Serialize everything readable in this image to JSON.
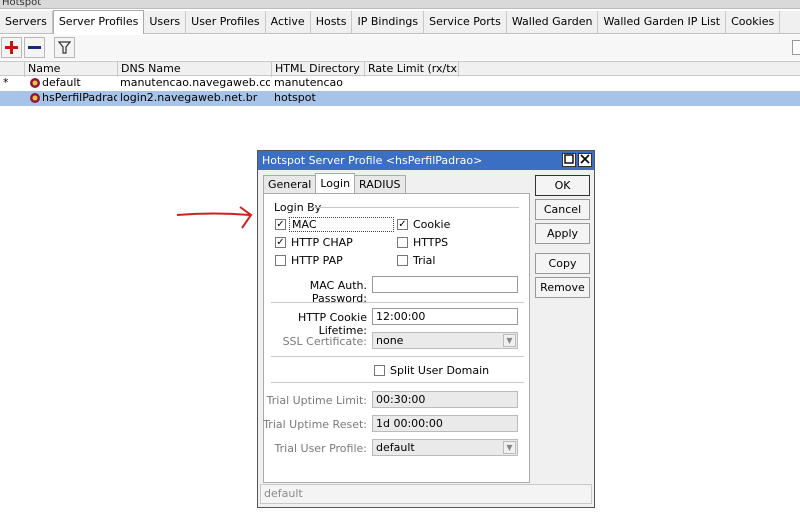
{
  "window": {
    "title": "Hotspot"
  },
  "tabs": [
    "Servers",
    "Server Profiles",
    "Users",
    "User Profiles",
    "Active",
    "Hosts",
    "IP Bindings",
    "Service Ports",
    "Walled Garden",
    "Walled Garden IP List",
    "Cookies"
  ],
  "active_tab": "Server Profiles",
  "toolbar": {
    "icons": [
      "add-icon",
      "remove-icon",
      "filter-icon"
    ]
  },
  "table": {
    "columns": [
      "Name",
      "DNS Name",
      "HTML Directory",
      "Rate Limit (rx/tx)"
    ],
    "rows": [
      {
        "marker": "*",
        "name": "default",
        "dns_name": "manutencao.navegaweb.com",
        "html_directory": "manutencao",
        "rate_limit": "",
        "selected": false
      },
      {
        "marker": "",
        "name": "hsPerfilPadrao",
        "dns_name": "login2.navegaweb.net.br",
        "html_directory": "hotspot",
        "rate_limit": "",
        "selected": true
      }
    ]
  },
  "dialog": {
    "title": "Hotspot Server Profile <hsPerfilPadrao>",
    "tabs": [
      "General",
      "Login",
      "RADIUS"
    ],
    "active_tab": "Login",
    "login_by": {
      "legend": "Login By",
      "options": [
        {
          "label": "MAC",
          "checked": true
        },
        {
          "label": "Cookie",
          "checked": true
        },
        {
          "label": "HTTP CHAP",
          "checked": true
        },
        {
          "label": "HTTPS",
          "checked": false
        },
        {
          "label": "HTTP PAP",
          "checked": false
        },
        {
          "label": "Trial",
          "checked": false
        }
      ]
    },
    "mac_auth_password": {
      "label": "MAC Auth. Password:",
      "value": ""
    },
    "http_cookie_lifetime": {
      "label": "HTTP Cookie Lifetime:",
      "value": "12:00:00"
    },
    "ssl_certificate": {
      "label": "SSL Certificate:",
      "value": "none"
    },
    "split_user_domain": {
      "label": "Split User Domain",
      "checked": false
    },
    "trial_uptime_limit": {
      "label": "Trial Uptime Limit:",
      "value": "00:30:00"
    },
    "trial_uptime_reset": {
      "label": "Trial Uptime Reset:",
      "value": "1d 00:00:00"
    },
    "trial_user_profile": {
      "label": "Trial User Profile:",
      "value": "default"
    },
    "buttons": {
      "ok": "OK",
      "cancel": "Cancel",
      "apply": "Apply",
      "copy": "Copy",
      "remove": "Remove"
    },
    "status": "default"
  },
  "colors": {
    "title_bar": "#3a6fc4",
    "selected_row": "#a7c4e8",
    "annotation_arrow": "#cc2222",
    "add_icon": "#cc1111",
    "remove_icon": "#1a2a6a"
  }
}
